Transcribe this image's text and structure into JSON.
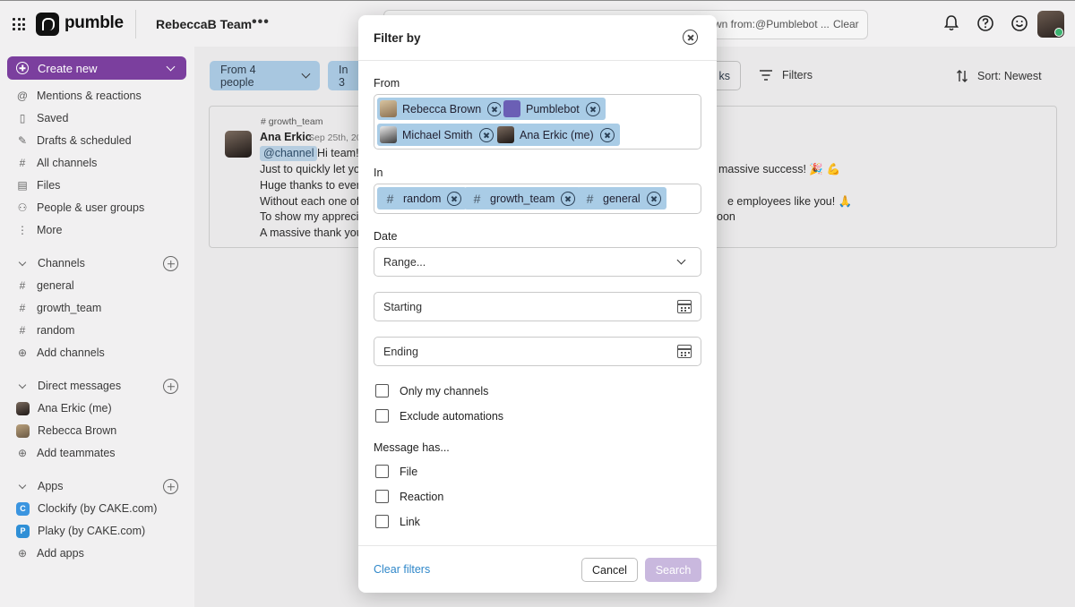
{
  "topbar": {
    "brand": "pumble",
    "team_name": "RebeccaB Team",
    "more_label": "•••",
    "search_text": "wn from:@Pumblebot ...",
    "search_clear": "Clear"
  },
  "sidebar": {
    "create_new": "Create new",
    "nav": [
      {
        "label": "Mentions & reactions",
        "icon": "@"
      },
      {
        "label": "Saved",
        "icon": "bookmark-icon"
      },
      {
        "label": "Drafts & scheduled",
        "icon": "pencil-icon"
      },
      {
        "label": "All channels",
        "icon": "hash-icon"
      },
      {
        "label": "Files",
        "icon": "file-icon"
      },
      {
        "label": "People & user groups",
        "icon": "people-icon"
      },
      {
        "label": "More",
        "icon": "more-vertical-icon"
      }
    ],
    "channels_header": "Channels",
    "channels": [
      "general",
      "growth_team",
      "random"
    ],
    "add_channels": "Add channels",
    "dm_header": "Direct messages",
    "dms": [
      "Ana Erkic (me)",
      "Rebecca Brown"
    ],
    "add_teammates": "Add teammates",
    "apps_header": "Apps",
    "apps": [
      "Clockify (by CAKE.com)",
      "Plaky (by CAKE.com)"
    ],
    "add_apps": "Add apps"
  },
  "main": {
    "from_pill": "From 4 people",
    "in_pill": "In 3",
    "filters_pill_partial": "ks",
    "filters_label": "Filters",
    "sort_label": "Sort: Newest",
    "message": {
      "channel": "# growth_team",
      "author": "Ana Erkic",
      "time": "Sep 25th, 20",
      "mention": "@channel",
      "line1": "Hi team!",
      "line2": "Just to quickly let you",
      "line3": "Huge thanks to every",
      "line4": "Without each one of y",
      "line5": "To show my apprecia",
      "line6": "A massive thank you c",
      "right1": "massive success! 🎉 💪",
      "right2": "e employees like you! 🙏",
      "right3": "oon"
    }
  },
  "modal": {
    "title": "Filter by",
    "from_label": "From",
    "from_chips": [
      "Rebecca Brown",
      "Pumblebot",
      "Michael Smith",
      "Ana Erkic (me)"
    ],
    "in_label": "In",
    "in_chips": [
      "random",
      "growth_team",
      "general"
    ],
    "date_label": "Date",
    "date_select": "Range...",
    "starting_placeholder": "Starting",
    "ending_placeholder": "Ending",
    "only_my_channels": "Only my channels",
    "exclude_automations": "Exclude automations",
    "message_has_label": "Message has...",
    "has_options": [
      "File",
      "Reaction",
      "Link"
    ],
    "clear_filters": "Clear filters",
    "cancel": "Cancel",
    "search": "Search"
  },
  "colors": {
    "accent_purple": "#7b3f9e",
    "chip_blue": "#a9cce6",
    "link_blue": "#2f87c9",
    "search_disabled": "#c9b8de"
  }
}
